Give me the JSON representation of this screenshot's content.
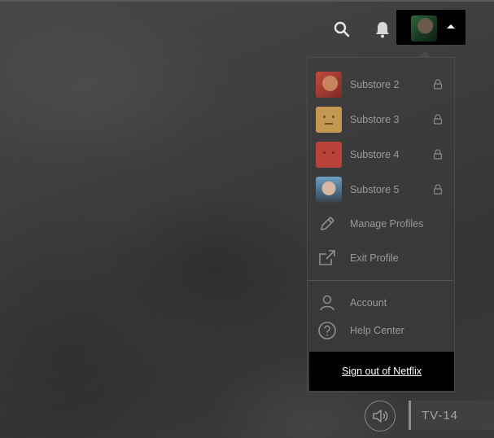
{
  "header": {
    "search_icon": "search-icon",
    "notifications_icon": "bell-icon",
    "profile_caret_icon": "caret-up-icon"
  },
  "profiles": [
    {
      "name": "Substore 2",
      "avatar": "avatar-man-mustache",
      "locked": true
    },
    {
      "name": "Substore 3",
      "avatar": "avatar-yellow-face",
      "locked": true
    },
    {
      "name": "Substore 4",
      "avatar": "avatar-red-face",
      "locked": true
    },
    {
      "name": "Substore 5",
      "avatar": "avatar-man-suit",
      "locked": true
    }
  ],
  "menu_actions": {
    "manage_profiles": "Manage Profiles",
    "exit_profile": "Exit Profile",
    "account": "Account",
    "help_center": "Help Center",
    "sign_out": "Sign out of Netflix"
  },
  "player": {
    "rating": "TV-14",
    "volume_icon": "volume-icon"
  },
  "colors": {
    "menu_text": "#9a9a9a",
    "sign_out_bg": "#000000",
    "overlay": "#3e3e3e"
  }
}
